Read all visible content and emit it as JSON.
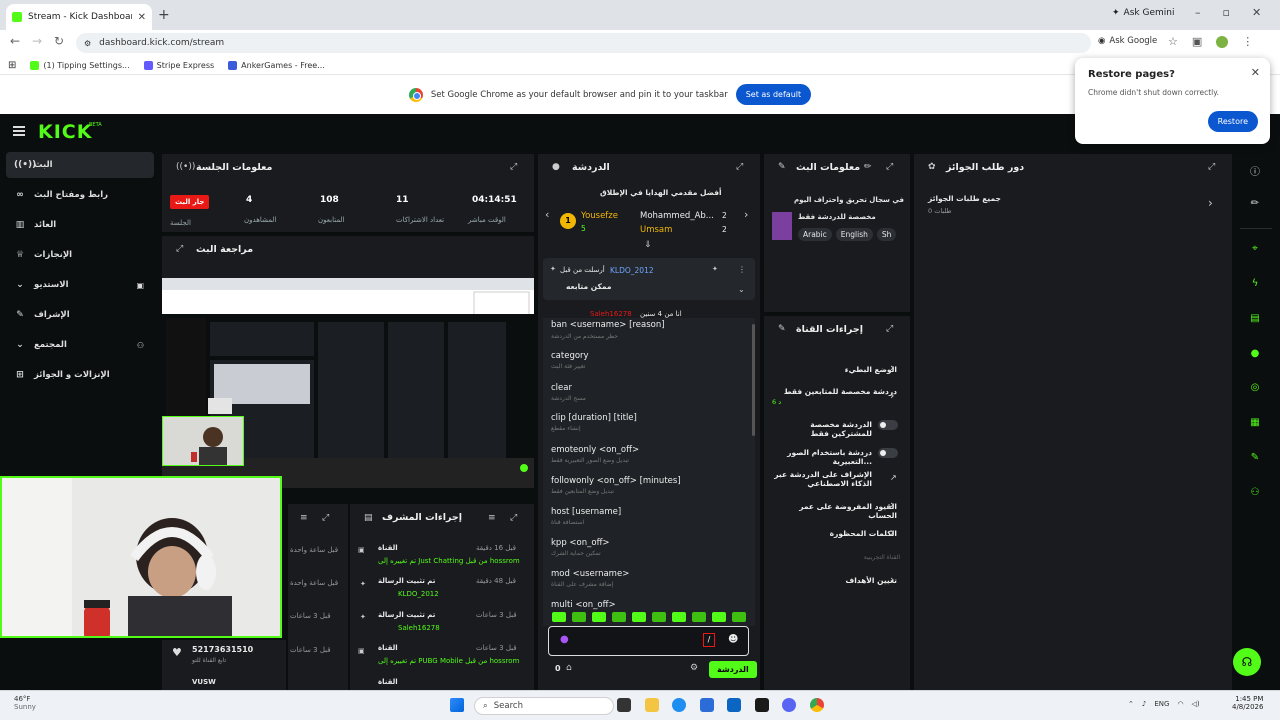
{
  "browser": {
    "tab_title": "Stream - Kick Dashboard",
    "ask_gemini": "Ask Gemini",
    "url": "dashboard.kick.com/stream",
    "ask_google": "Ask Google",
    "bookmarks": [
      "(1) Tipping Settings...",
      "Stripe Express",
      "AnkerGames - Free..."
    ],
    "infobar_text": "Set Google Chrome as your default browser and pin it to your taskbar",
    "set_default": "Set as default",
    "restore_title": "Restore pages?",
    "restore_desc": "Chrome didn't shut down correctly.",
    "restore_btn": "Restore"
  },
  "kick": {
    "logo": "KICK",
    "beta": "BETA"
  },
  "sidebar": {
    "items": [
      {
        "label": "البث",
        "icon": "broadcast-icon"
      },
      {
        "label": "رابط ومفتاح البث",
        "icon": "link-icon"
      },
      {
        "label": "العائد",
        "icon": "chart-icon"
      },
      {
        "label": "الإنجازات",
        "icon": "trophy-icon"
      },
      {
        "label": "الاستديو",
        "icon": "studio-icon"
      },
      {
        "label": "الإشراف",
        "icon": "wrench-icon"
      },
      {
        "label": "المجتمع",
        "icon": "community-icon"
      },
      {
        "label": "الإنزالات و الجوائز",
        "icon": "gift-icon"
      }
    ]
  },
  "session": {
    "title": "معلومات الجلسة",
    "live_badge": "جار البث",
    "session_label": "الجلسة",
    "stats": [
      {
        "value": "04:14:51",
        "label": "الوقت مباشر"
      },
      {
        "value": "11",
        "label": "تعداد الاشتراكات"
      },
      {
        "value": "108",
        "label": "المتابعون"
      },
      {
        "value": "4",
        "label": "المشاهدون"
      }
    ]
  },
  "review": {
    "title": "مراجعة البث"
  },
  "mod_actions": {
    "title": "إجراءات المشرف",
    "rows": [
      {
        "title": "القناة",
        "desc": "تم تغييره إلى Just Chatting من قبل hossrom",
        "time": "قبل 16 دقيقة"
      },
      {
        "title": "تم تثبيت الرسالة",
        "desc": "KLDO_2012",
        "time": "قبل 48 دقيقة"
      },
      {
        "title": "تم تثبيت الرسالة",
        "desc": "Saleh16278",
        "time": "قبل 3 ساعات"
      },
      {
        "title": "القناة",
        "desc": "تم تغييره إلى PUBG Mobile من قبل hossrom",
        "time": "قبل 3 ساعات"
      }
    ],
    "left_times": [
      "قبل ساعة واحدة",
      "قبل ساعة واحدة",
      "قبل 3 ساعات",
      "قبل 3 ساعات"
    ],
    "donor_id": "52173631510",
    "donor_desc": "تابع القناة للتو",
    "donor_next": "VUSW"
  },
  "chat": {
    "title": "الدردشة",
    "top_gifters": "أفضل مقدمي الهدايا في الإطلاق",
    "gifter1": "Yousefze",
    "gifter1_count": "5",
    "gifter2": "Mohammed_Ab...",
    "gifter2_count": "2",
    "gifter3": "Umsam",
    "gifter3_count": "2",
    "pinned_by": "أرسلت من قبل",
    "pinned_user": "KLDO_2012",
    "pinned_msg": "ممكن متابعه",
    "msg_user": "Saleh16278",
    "msg_text": "انا من 4 سنين",
    "commands": [
      {
        "cmd": "ban <username> [reason]",
        "desc": "حظر مستخدم من الدردشة"
      },
      {
        "cmd": "category",
        "desc": "تغيير فئة البث"
      },
      {
        "cmd": "clear",
        "desc": "مسح الدردشة"
      },
      {
        "cmd": "clip [duration] [title]",
        "desc": "إنشاء مقطع"
      },
      {
        "cmd": "emoteonly <on_off>",
        "desc": "تبديل وضع الصور التعبيرية فقط"
      },
      {
        "cmd": "followonly <on_off> [minutes]",
        "desc": "تبديل وضع المتابعين فقط"
      },
      {
        "cmd": "host [username]",
        "desc": "استضافة قناة"
      },
      {
        "cmd": "kpp <on_off>",
        "desc": "تمكين حماية الشرك"
      },
      {
        "cmd": "mod <username>",
        "desc": "إضافة مشرف على القناة"
      },
      {
        "cmd": "multi <on_off>",
        "desc": ""
      }
    ],
    "input_value": "/",
    "count": "0",
    "send_label": "الدردشة"
  },
  "stream_info": {
    "title": "معلومات البث",
    "stream_title": "في سجال تحريق واحتراف اليوم",
    "category": "مخصصة للدردشة فقط",
    "tags": [
      "Arabic",
      "English",
      "Sh"
    ]
  },
  "channel_actions": {
    "title": "إجراءات القناة",
    "rows": [
      {
        "label": "الوضع البطيء",
        "type": "chevron"
      },
      {
        "label": "دردشة مخصصة للمتابعين فقط",
        "sub": "6 د",
        "type": "chevron"
      },
      {
        "label": "الدردشة مخصصة للمشتركين فقط",
        "type": "toggle"
      },
      {
        "label": "دردشة باستخدام الصور التعبيرية...",
        "type": "toggle"
      },
      {
        "label": "الإشراف على الدردشة عبر الذكاء الاصطناعي",
        "type": "external"
      },
      {
        "label": "القيود المفروضة على عمر الحساب",
        "type": "chevron"
      },
      {
        "label": "الكلمات المحظورة",
        "type": "chevron"
      },
      {
        "label": "تعيين الأهداف",
        "type": "chevron"
      }
    ],
    "section_hint": "القناة التجريبية"
  },
  "prizes": {
    "title": "دور طلب الجوائز",
    "all_requests": "جميع طلبات الجوائز",
    "count_label": "0 طلبات"
  },
  "taskbar": {
    "temp": "46°F",
    "weather": "Sunny",
    "search": "Search",
    "lang": "ENG",
    "time": "1:45 PM",
    "date": "4/8/2026"
  },
  "colors": {
    "accent": "#53fc18",
    "panel": "#191b1f",
    "live": "#e91916"
  }
}
